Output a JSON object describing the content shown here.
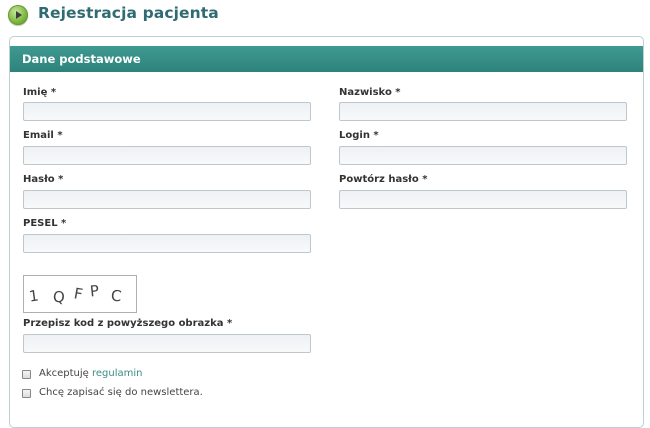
{
  "header": {
    "title": "Rejestracja pacjenta",
    "icon": "play-circle-icon"
  },
  "panel": {
    "title": "Dane podstawowe"
  },
  "fields": {
    "first_name": {
      "label": "Imię *",
      "value": ""
    },
    "last_name": {
      "label": "Nazwisko *",
      "value": ""
    },
    "email": {
      "label": "Email *",
      "value": ""
    },
    "login": {
      "label": "Login *",
      "value": ""
    },
    "password": {
      "label": "Hasło *",
      "value": ""
    },
    "password_repeat": {
      "label": "Powtórz hasło *",
      "value": ""
    },
    "pesel": {
      "label": "PESEL *",
      "value": ""
    },
    "captcha_code": {
      "label": "Przepisz kod z powyższego obrazka *",
      "value": ""
    }
  },
  "captcha": {
    "chars": [
      "1",
      "Q",
      "F",
      "P",
      "C"
    ]
  },
  "checkboxes": {
    "terms": {
      "label_prefix": "Akceptuję ",
      "link_text": "regulamin",
      "checked": false
    },
    "newsletter": {
      "label": "Chcę zapisać się do newslettera.",
      "checked": false
    }
  },
  "colors": {
    "accent": "#2f8a82",
    "title": "#2f6b73",
    "link": "#3b8d86"
  }
}
